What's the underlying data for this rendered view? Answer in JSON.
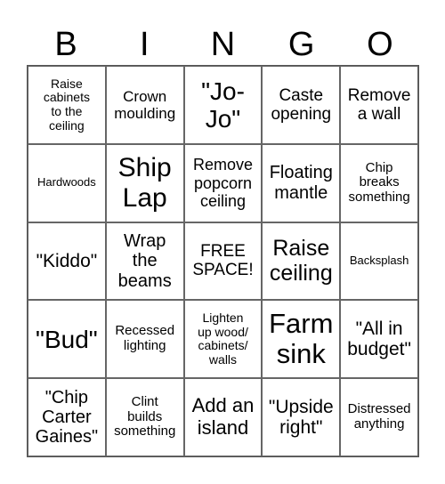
{
  "header": [
    "B",
    "I",
    "N",
    "G",
    "O"
  ],
  "cells": [
    "Raise\ncabinets\nto the\nceiling",
    "Crown\nmoulding",
    "\"Jo-\nJo\"",
    "Caste\nopening",
    "Remove\na wall",
    "Hardwoods",
    "Ship\nLap",
    "Remove\npopcorn\nceiling",
    "Floating\nmantle",
    "Chip\nbreaks\nsomething",
    "\"Kiddo\"",
    "Wrap\nthe\nbeams",
    "FREE\nSPACE!",
    "Raise\nceiling",
    "Backsplash",
    "\"Bud\"",
    "Recessed\nlighting",
    "Lighten\nup wood/\ncabinets/\nwalls",
    "Farm\nsink",
    "\"All in\nbudget\"",
    "\"Chip\nCarter\nGaines\"",
    "Clint\nbuilds\nsomething",
    "Add an\nisland",
    "\"Upside\nright\"",
    "Distressed\nanything"
  ]
}
